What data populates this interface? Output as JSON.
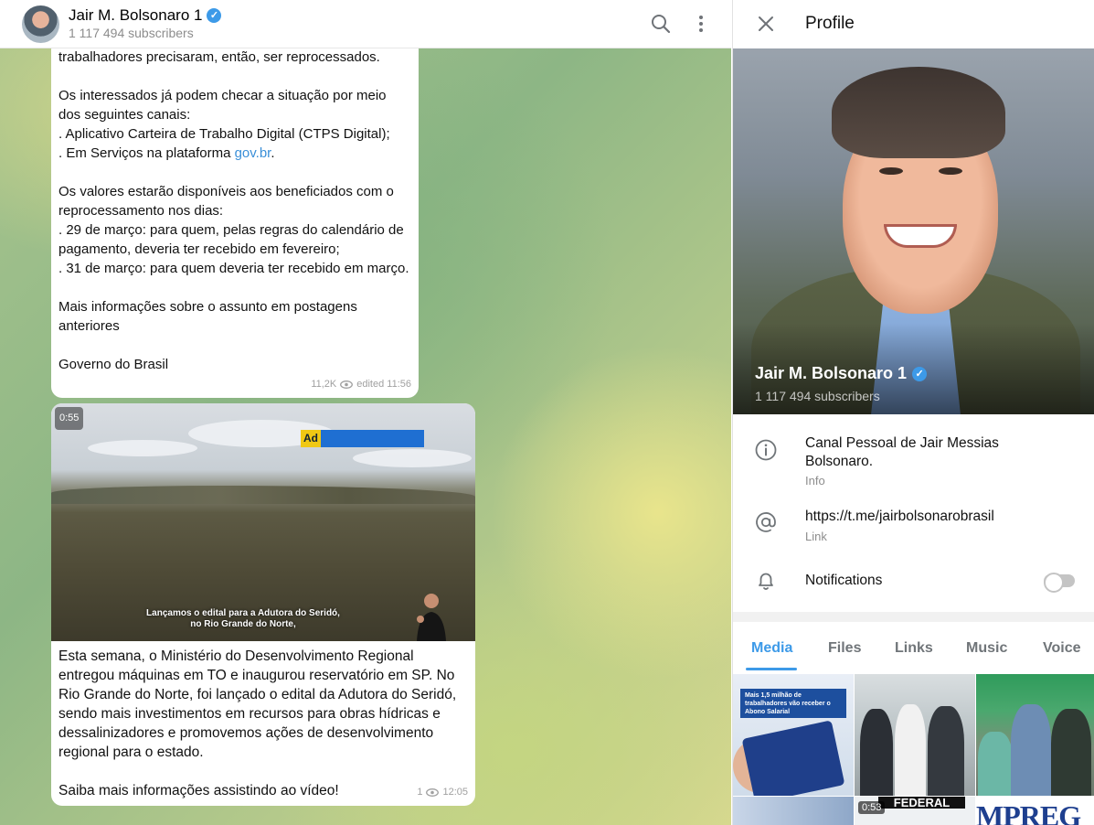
{
  "channel": {
    "name": "Jair M. Bolsonaro 1",
    "subscribers": "1 117 494 subscribers"
  },
  "icons": {
    "search": "search-icon",
    "more": "more-vertical-icon",
    "close": "close-icon",
    "info": "info-icon",
    "at": "at-sign-icon",
    "bell": "bell-icon",
    "views": "eye-icon",
    "verified": "verified-badge-icon"
  },
  "messages": [
    {
      "text_before_link": "trabalhadores precisaram, então, ser reprocessados.\n\nOs interessados já podem checar a situação por meio dos seguintes canais:\n. Aplicativo Carteira de Trabalho Digital (CTPS Digital);\n. Em Serviços na plataforma ",
      "link": "gov.br",
      "text_after_link": ".\n\nOs valores estarão disponíveis aos beneficiados com o reprocessamento nos dias:\n. 29 de março: para quem, pelas regras do calendário de pagamento, deveria ter recebido em fevereiro;\n. 31 de março: para quem deveria ter recebido em março.\n\nMais informações sobre o assunto em postagens anteriores\n\nGoverno do Brasil",
      "views": "11,2K",
      "time": "edited 11:56"
    },
    {
      "video_duration": "0:55",
      "video_overlay_label": "Ad",
      "video_caption": "Lançamos o edital para a Adutora do Seridó,\nno Rio Grande do Norte,",
      "text": "Esta semana, o Ministério do Desenvolvimento Regional entregou máquinas em TO e inaugurou reservatório em SP. No Rio Grande do Norte, foi lançado o edital da Adutora do Seridó, sendo mais investimentos em recursos para obras hídricas e dessalinizadores e promovemos ações de desenvolvimento regional para o estado.\n\nSaiba mais informações assistindo ao vídeo!",
      "views": "1",
      "time": "12:05"
    }
  ],
  "profile": {
    "title": "Profile",
    "name": "Jair M. Bolsonaro 1",
    "subscribers": "1 117 494 subscribers",
    "info_text": "Canal Pessoal de Jair Messias\nBolsonaro.",
    "info_label": "Info",
    "link_text": "https://t.me/jairbolsonarobrasil",
    "link_label": "Link",
    "notifications_label": "Notifications",
    "notifications_enabled": false,
    "tabs": [
      "Media",
      "Files",
      "Links",
      "Music",
      "Voice"
    ],
    "active_tab": "Media",
    "media": {
      "thumb1_banner": "Mais 1,5 milhão de trabalhadores vão receber o Abono Salarial",
      "thumb5_label": "FEDERAL",
      "thumb5_duration": "0:53",
      "thumb6_text": "MPREG"
    }
  },
  "colors": {
    "accent": "#3d9ae8",
    "link": "#3a8fd8",
    "muted": "#8d8d8d"
  }
}
